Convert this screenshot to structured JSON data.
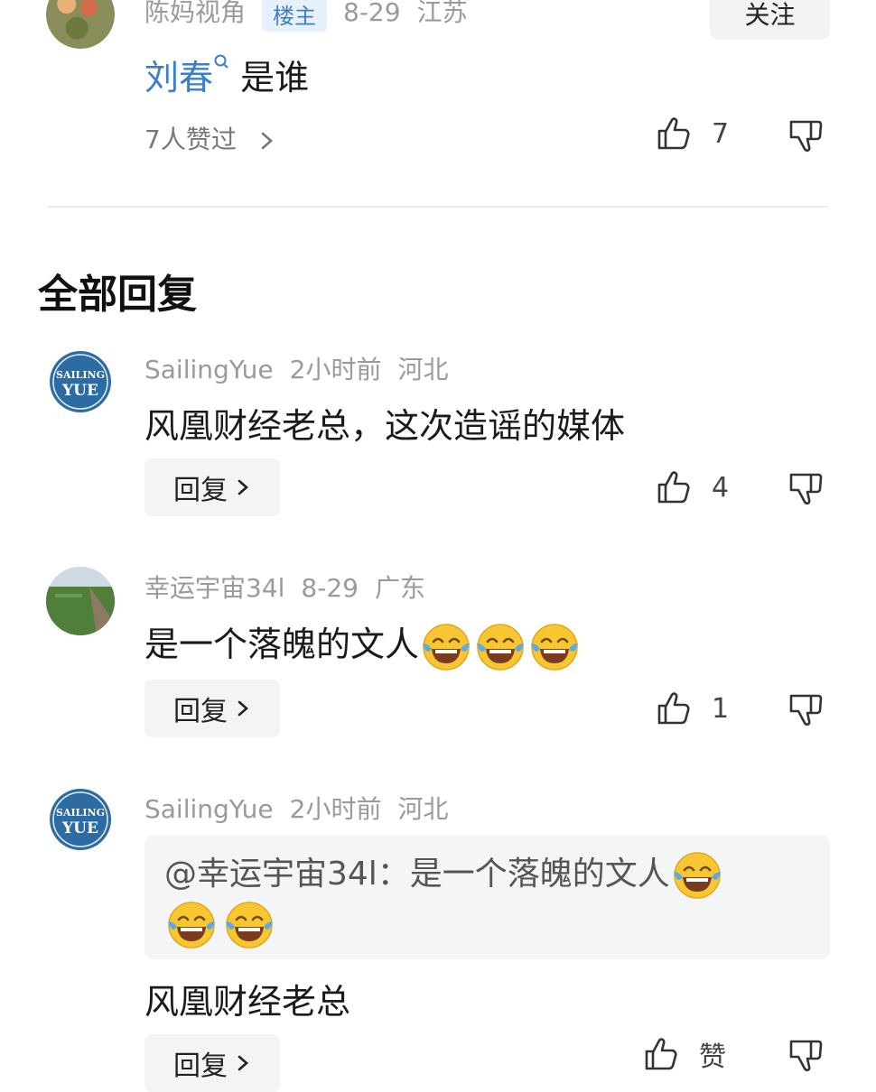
{
  "top_comment": {
    "username": "陈妈视角",
    "badge": "楼主",
    "date": "8-29",
    "location": "江苏",
    "follow_label": "关注",
    "mention": "刘春",
    "text": "是谁",
    "liked_by": "7人赞过",
    "likes": "7"
  },
  "section_title": "全部回复",
  "replies": [
    {
      "username": "SailingYue",
      "time": "2小时前",
      "location": "河北",
      "avatar_text": "SAILING YUE",
      "text": "风凰财经老总，这次造谣的媒体",
      "reply_label": "回复",
      "likes": "4"
    },
    {
      "username": "幸运宇宙34l",
      "time": "8-29",
      "location": "广东",
      "text": "是一个落魄的文人",
      "reply_label": "回复",
      "likes": "1"
    },
    {
      "username": "SailingYue",
      "time": "2小时前",
      "location": "河北",
      "avatar_text": "SAILING YUE",
      "quote": "@幸运宇宙34l：是一个落魄的文人",
      "text": "风凰财经老总",
      "reply_label": "回复",
      "likes": "赞"
    }
  ],
  "icons": {
    "like": "thumbs-up-icon",
    "dislike": "thumbs-down-icon",
    "chevron": "chevron-right-icon",
    "emoji": "tears-of-joy-emoji"
  },
  "colors": {
    "mention": "#3c7fc7",
    "meta": "#9a9a9a",
    "badge_bg": "#e7f1fb"
  }
}
